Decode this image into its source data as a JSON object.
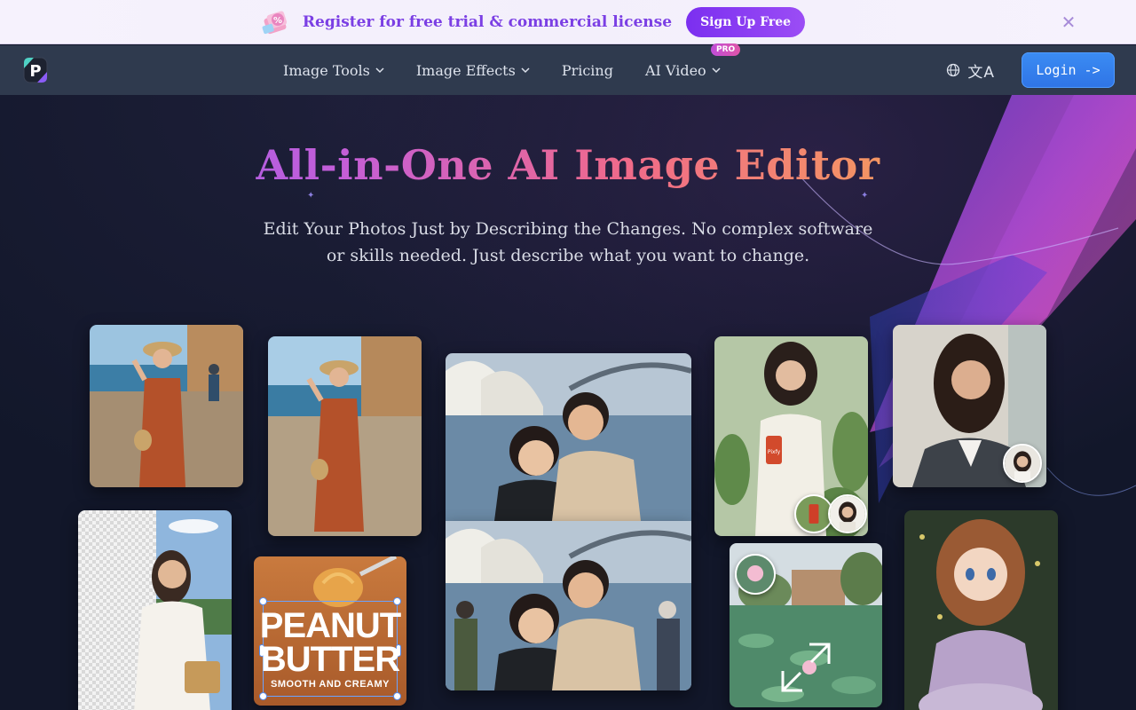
{
  "promo": {
    "text": "Register for free trial & commercial license",
    "signup_label": "Sign Up Free",
    "close_glyph": "✕"
  },
  "nav": {
    "items": [
      {
        "label": "Image Tools",
        "has_dropdown": true
      },
      {
        "label": "Image Effects",
        "has_dropdown": true
      },
      {
        "label": "Pricing",
        "has_dropdown": false
      },
      {
        "label": "AI Video",
        "has_dropdown": true,
        "badge": "PRO"
      }
    ],
    "language_label": "文A",
    "login_label": "Login ->"
  },
  "hero": {
    "title": "All-in-One AI Image Editor",
    "subtitle": "Edit Your Photos Just by Describing the Changes. No complex software or skills needed. Just describe what you want to change."
  },
  "cards": {
    "peanut_title_line1": "PEANUT",
    "peanut_title_line2": "BUTTER",
    "peanut_sub": "SMOOTH AND CREAMY",
    "can_label": "Pixfy"
  },
  "colors": {
    "accent_purple": "#7b3fe4",
    "login_blue": "#2f74e6",
    "nav_bg": "#2f3a4e",
    "hero_bg": "#12172a"
  },
  "icons": [
    "gift-icon",
    "close-icon",
    "logo-icon",
    "chevron-down-icon",
    "globe-icon",
    "expand-arrows-icon"
  ]
}
